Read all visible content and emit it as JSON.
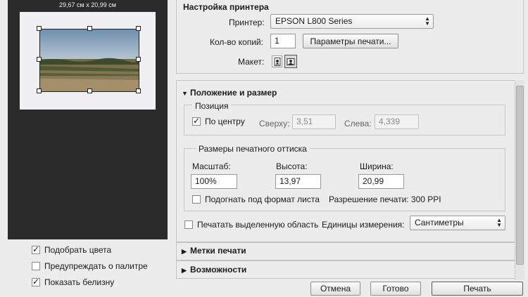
{
  "preview": {
    "paper_size": "29,67 см x 20,99 см"
  },
  "left_options": [
    {
      "label": "Подобрать цвета",
      "checked": true
    },
    {
      "label": "Предупреждать о палитре",
      "checked": false
    },
    {
      "label": "Показать белизну",
      "checked": true
    }
  ],
  "printer_setup": {
    "title": "Настройка принтера",
    "printer_label": "Принтер:",
    "printer_value": "EPSON L800 Series",
    "copies_label": "Кол-во копий:",
    "copies_value": "1",
    "print_settings_button": "Параметры печати...",
    "layout_label": "Макет:"
  },
  "position_size": {
    "title": "Положение и размер",
    "position": {
      "legend": "Позиция",
      "center_label": "По центру",
      "center_checked": true,
      "top_label": "Сверху:",
      "top_value": "3,51",
      "left_label": "Слева:",
      "left_value": "4,339"
    },
    "print_size": {
      "legend": "Размеры печатного оттиска",
      "scale_label": "Масштаб:",
      "scale_value": "100%",
      "height_label": "Высота:",
      "height_value": "13,97",
      "width_label": "Ширина:",
      "width_value": "20,99",
      "fit_label": "Подогнать под формат листа",
      "fit_checked": false,
      "resolution_text": "Разрешение печати: 300 PPI"
    },
    "print_selection_label": "Печатать выделенную область",
    "print_selection_checked": false,
    "units_label": "Единицы измерения:",
    "units_value": "Сантиметры"
  },
  "sections": [
    {
      "title": "Метки печати"
    },
    {
      "title": "Возможности"
    }
  ],
  "footer": {
    "cancel": "Отмена",
    "done": "Готово",
    "print": "Печать"
  }
}
